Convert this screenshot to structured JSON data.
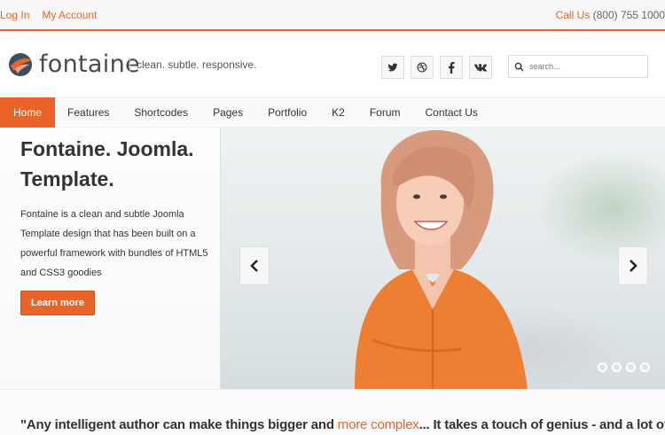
{
  "topbar": {
    "login": "Log In",
    "account": "My Account",
    "call_label": "Call Us",
    "phone": "(800) 755 1000"
  },
  "header": {
    "logo_text": "fontaine",
    "tagline": "clean. subtle. responsive.",
    "social": [
      {
        "icon": "twitter-icon",
        "glyph": "🐦"
      },
      {
        "icon": "dribbble-icon",
        "glyph": "◍"
      },
      {
        "icon": "facebook-icon",
        "glyph": "f"
      },
      {
        "icon": "vk-icon",
        "glyph": "vk"
      }
    ],
    "search_placeholder": "search..."
  },
  "nav": {
    "items": [
      "Home",
      "Features",
      "Shortcodes",
      "Pages",
      "Portfolio",
      "K2",
      "Forum",
      "Contact Us"
    ]
  },
  "hero": {
    "title": "Fontaine. Joomla. Template.",
    "text": "Fontaine is a clean and subtle Joomla Template design that has been built on a powerful framework with bundles of HTML5 and CSS3 goodies",
    "button": "Learn more",
    "prev_arrow": "‹",
    "next_arrow": "›",
    "slide_count": 4
  },
  "quote": {
    "before": "\"Any intelligent author can make things bigger and ",
    "highlight": "more complex",
    "after": "... It takes a touch of genius - and a lot of"
  },
  "colors": {
    "accent": "#e8642a",
    "text": "#333333"
  }
}
